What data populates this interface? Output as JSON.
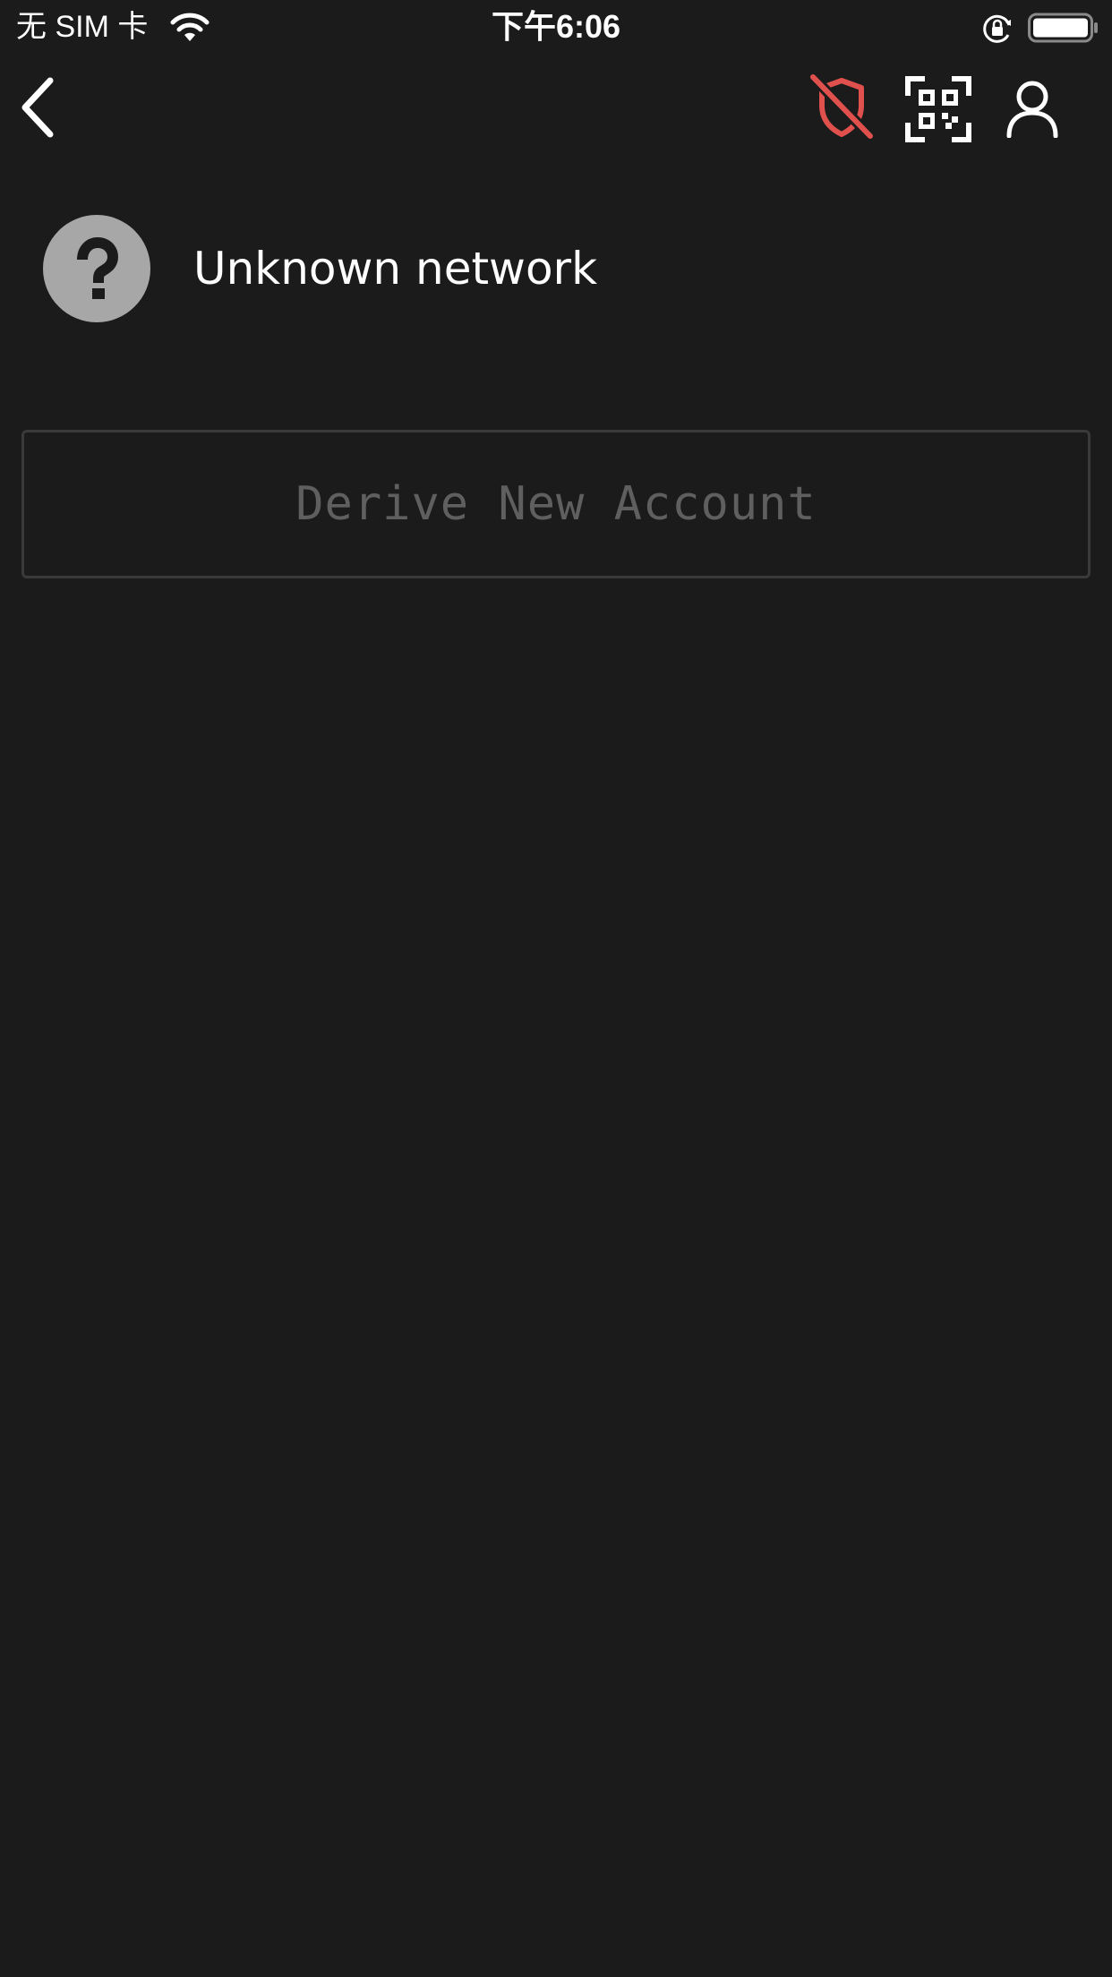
{
  "status_bar": {
    "carrier": "无 SIM 卡",
    "time": "下午6:06",
    "icons": [
      "wifi-icon",
      "rotation-lock-icon",
      "battery-icon"
    ]
  },
  "nav": {
    "back_icon": "chevron-left-icon",
    "actions": [
      {
        "icon": "shield-off-icon",
        "color": "#e0504d"
      },
      {
        "icon": "qr-scan-icon",
        "color": "#ffffff"
      },
      {
        "icon": "user-icon",
        "color": "#ffffff"
      }
    ]
  },
  "network": {
    "name": "Unknown network",
    "avatar_icon": "question-mark-icon",
    "avatar_color": "#a7a7a7"
  },
  "derive_button": {
    "label": "Derive New Account"
  },
  "colors": {
    "background": "#1b1b1b",
    "text": "#ffffff",
    "muted_text": "#5f5f5f",
    "border": "#3a3a3a",
    "danger": "#e0504d"
  }
}
